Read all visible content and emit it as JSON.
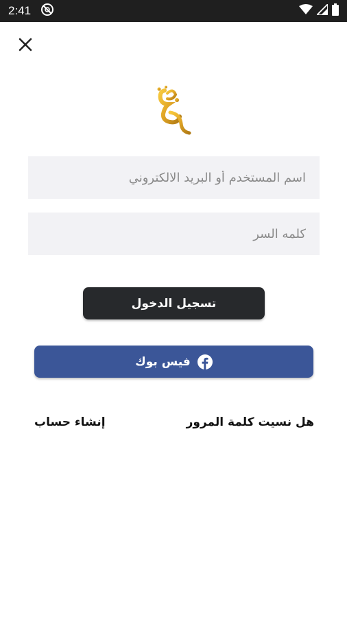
{
  "status_bar": {
    "time": "2:41",
    "icons": [
      "do-not-disturb-icon",
      "wifi-icon",
      "signal-icon",
      "battery-icon"
    ]
  },
  "header": {
    "close_icon": "close-icon"
  },
  "logo": {
    "icon": "arabic-calligraphy-logo",
    "color": "#e0a526"
  },
  "form": {
    "username_placeholder": "اسم المستخدم أو البريد الالكتروني",
    "password_placeholder": "كلمه السر"
  },
  "buttons": {
    "login_label": "تسجيل الدخول",
    "facebook_label": "فيس بوك",
    "facebook_icon": "facebook-icon"
  },
  "links": {
    "forgot_password": "هل نسيت كلمة المرور",
    "create_account": "إنشاء حساب"
  },
  "colors": {
    "status_bar": "#1f1f1f",
    "field_bg": "#f2f2f5",
    "login_bg": "#27292c",
    "facebook_bg": "#3b5698"
  }
}
